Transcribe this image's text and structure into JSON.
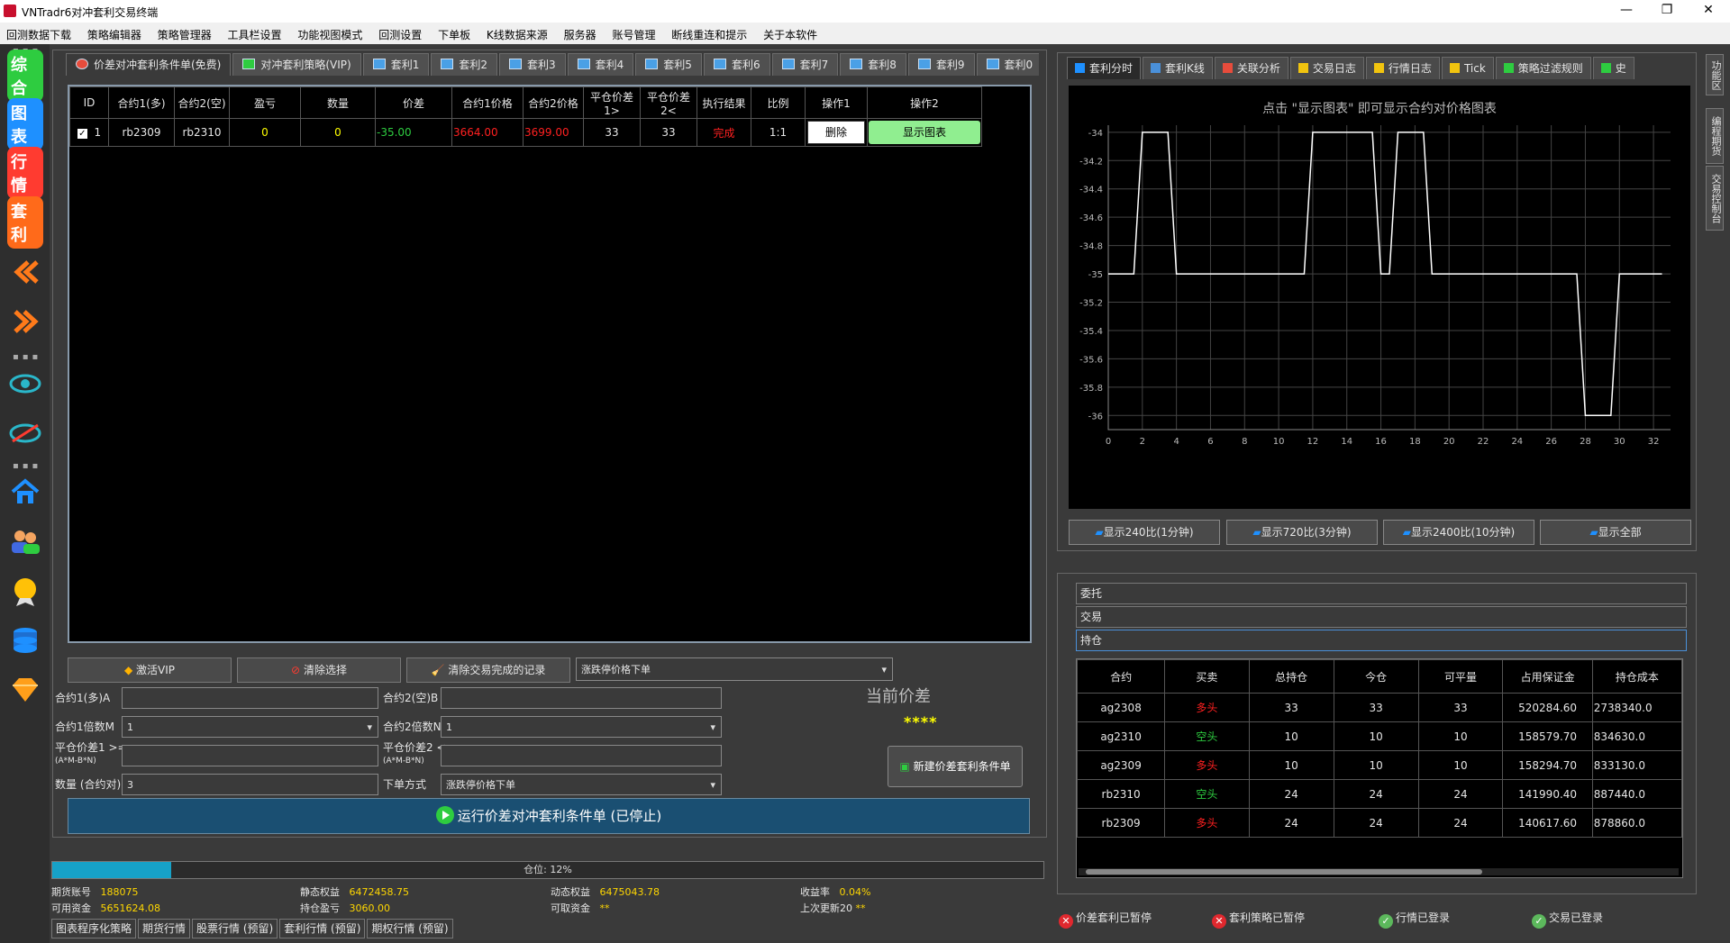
{
  "window": {
    "title": "VNTradr6对冲套利交易终端",
    "minimize": "—",
    "maximize": "❐",
    "close": "✕"
  },
  "menu": [
    "回测数据下载",
    "策略编辑器",
    "策略管理器",
    "工具栏设置",
    "功能视图模式",
    "回测设置",
    "下单板",
    "K线数据来源",
    "服务器",
    "账号管理",
    "断线重连和提示",
    "关于本软件"
  ],
  "sidebar": {
    "items": [
      "综合",
      "图表",
      "行情",
      "套利"
    ],
    "colors": [
      "#2ecc40",
      "#1e90ff",
      "#ff3b30",
      "#ff6a1a"
    ]
  },
  "tabs": [
    "价差对冲套利条件单(免费)",
    "对冲套利策略(VIP)",
    "套利1",
    "套利2",
    "套利3",
    "套利4",
    "套利5",
    "套利6",
    "套利7",
    "套利8",
    "套利9",
    "套利0"
  ],
  "grid": {
    "headers": [
      "ID",
      "合约1(多)",
      "合约2(空)",
      "盈亏",
      "数量",
      "价差",
      "合约1价格",
      "合约2价格",
      "平仓价差1>",
      "平仓价差2<",
      "执行结果",
      "比例",
      "操作1",
      "操作2"
    ],
    "row": {
      "checked": "✓",
      "id": "1",
      "c1": "rb2309",
      "c2": "rb2310",
      "pnl": "0",
      "qty": "0",
      "spread": "-35.00",
      "p1": "3664.00",
      "p2": "3699.00",
      "close1": "33",
      "close2": "33",
      "result": "完成",
      "ratio": "1:1",
      "op1": "删除",
      "op2": "显示图表"
    }
  },
  "buttons": {
    "activate_vip": "激活VIP",
    "clear_selection": "清除选择",
    "clear_done": "清除交易完成的记录",
    "order_mode": "涨跌停价格下单"
  },
  "form": {
    "c1_label": "合约1(多)A",
    "c1_value": "",
    "c2_label": "合约2(空)B",
    "c2_value": "",
    "m1_label": "合约1倍数M",
    "m1_value": "1",
    "m2_label": "合约2倍数N",
    "m2_value": "1",
    "close1_label": "平仓价差1 >=",
    "close1_sub": "(A*M-B*N)",
    "close1_value": "",
    "close2_label": "平仓价差2 <=",
    "close2_sub": "(A*M-B*N)",
    "close2_value": "",
    "qty_label": "数量 (合约对)",
    "qty_value": "3",
    "mode_label": "下单方式",
    "mode_value": "涨跌停价格下单",
    "current_spread_label": "当前价差",
    "current_spread_value": "****",
    "new_button": "新建价差套利条件单",
    "run_button": "运行价差对冲套利条件单 (已停止)"
  },
  "progress": {
    "label": "仓位: 12%",
    "fraction": 0.12
  },
  "account": {
    "futures_account_label": "期货账号",
    "futures_account_value": "188075",
    "available_label": "可用资金",
    "available_value": "5651624.08",
    "static_equity_label": "静态权益",
    "static_equity_value": "6472458.75",
    "position_pnl_label": "持仓盈亏",
    "position_pnl_value": "3060.00",
    "dynamic_equity_label": "动态权益",
    "dynamic_equity_value": "6475043.78",
    "withdrawable_label": "可取资金",
    "withdrawable_value": "**",
    "return_label": "收益率",
    "return_value": "0.04%",
    "last_update_label": "上次更新20",
    "last_update_value": "**"
  },
  "bottom_tabs": [
    "图表程序化策略",
    "期货行情",
    "股票行情 (预留)",
    "套利行情 (预留)",
    "期权行情 (预留)"
  ],
  "right_tabs": [
    "套利分时",
    "套利K线",
    "关联分析",
    "交易日志",
    "行情日志",
    "Tick",
    "策略过滤规则",
    "史"
  ],
  "chart_hint": "点击 \"显示图表\" 即可显示合约对价格图表",
  "chart_data": {
    "type": "line",
    "x": [
      0,
      1,
      2,
      3,
      4,
      5,
      6,
      7,
      8,
      9,
      10,
      11,
      12,
      13,
      14,
      15,
      16,
      17,
      18,
      19,
      20,
      21,
      22,
      23,
      24,
      25,
      26,
      27,
      28,
      29,
      30,
      31,
      32
    ],
    "values": [
      -35,
      -35,
      -34,
      -34,
      -35,
      -35,
      -35,
      -35,
      -35,
      -35,
      -35,
      -35,
      -34,
      -34,
      -34,
      -34,
      -35,
      -34,
      -34,
      -35,
      -35,
      -35,
      -35,
      -35,
      -35,
      -35,
      -35,
      -35,
      -36,
      -36,
      -35,
      -35,
      -35
    ],
    "xlim": [
      0,
      33
    ],
    "ylim": [
      -36.1,
      -33.95
    ],
    "xticks": [
      "0",
      "2",
      "4",
      "6",
      "8",
      "10",
      "12",
      "14",
      "16",
      "18",
      "20",
      "22",
      "24",
      "26",
      "28",
      "30",
      "32"
    ],
    "yticks": [
      "-34",
      "-34.2",
      "-34.4",
      "-34.6",
      "-34.8",
      "-35",
      "-35.2",
      "-35.4",
      "-35.6",
      "-35.8",
      "-36"
    ],
    "line_color": "#ffffff"
  },
  "range_buttons": [
    "显示240比(1分钟)",
    "显示720比(3分钟)",
    "显示2400比(10分钟)",
    "显示全部"
  ],
  "sections": [
    "委托",
    "交易",
    "持仓"
  ],
  "positions": {
    "headers": [
      "合约",
      "买卖",
      "总持仓",
      "今仓",
      "可平量",
      "占用保证金",
      "持仓成本"
    ],
    "rows": [
      [
        "ag2308",
        "多头",
        "33",
        "33",
        "33",
        "520284.60",
        "2738340.0"
      ],
      [
        "ag2310",
        "空头",
        "10",
        "10",
        "10",
        "158579.70",
        "834630.0"
      ],
      [
        "ag2309",
        "多头",
        "10",
        "10",
        "10",
        "158294.70",
        "833130.0"
      ],
      [
        "rb2310",
        "空头",
        "24",
        "24",
        "24",
        "141990.40",
        "887440.0"
      ],
      [
        "rb2309",
        "多头",
        "24",
        "24",
        "24",
        "140617.60",
        "878860.0"
      ]
    ]
  },
  "status": [
    "价差套利已暂停",
    "套利策略已暂停",
    "行情已登录",
    "交易已登录"
  ],
  "vtabs": [
    "功能区",
    "编程期货",
    "交易控制台"
  ]
}
